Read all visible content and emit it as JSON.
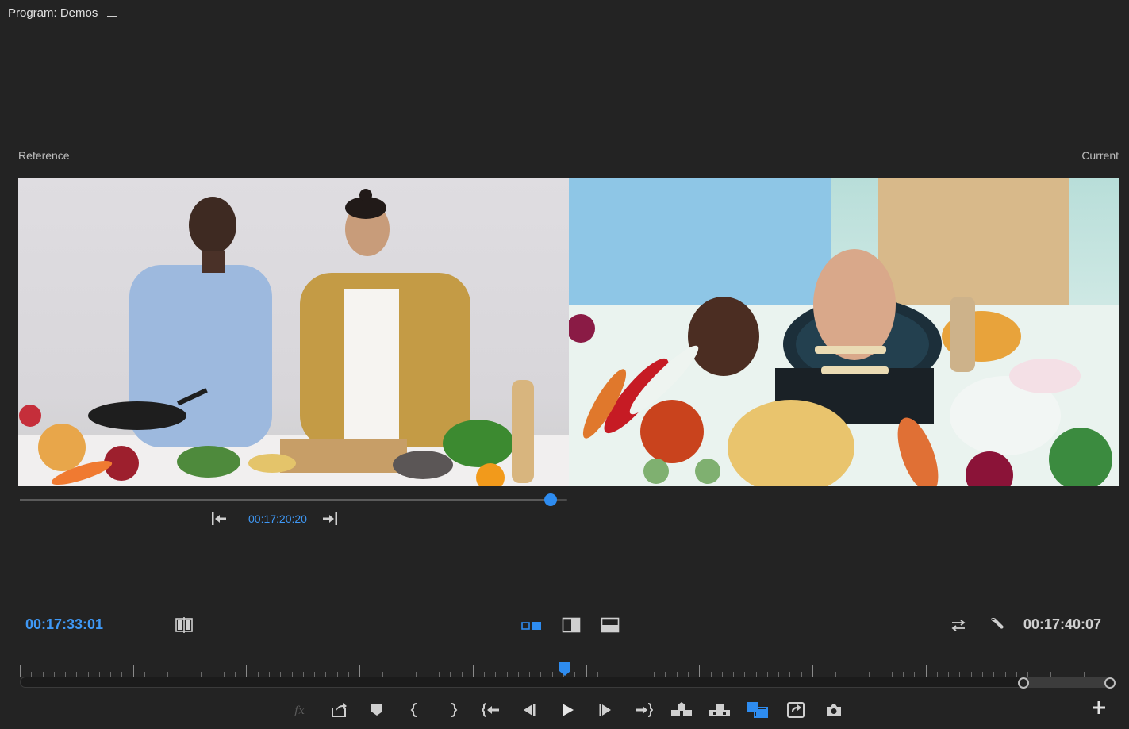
{
  "panel": {
    "title": "Program: Demos",
    "menu_icon": "hamburger-menu-icon"
  },
  "viewer": {
    "reference_label": "Reference",
    "current_label": "Current"
  },
  "reference": {
    "timecode": "00:17:20:20",
    "scrub_position": 0.97,
    "go_to_previous_edit_icon": "go-to-previous-edit-icon",
    "go_to_next_edit_icon": "go-to-next-edit-icon"
  },
  "playhead": {
    "current_timecode": "00:17:33:01",
    "duration_timecode": "00:17:40:07"
  },
  "toolbar": {
    "comparison_icon": "comparison-view-icon",
    "side_by_side_icon": "side-by-side-icon",
    "vertical_split_icon": "vertical-split-icon",
    "horizontal_split_icon": "horizontal-split-icon",
    "swap_icon": "swap-sides-icon",
    "settings_icon": "wrench-icon"
  },
  "timeline": {
    "playhead_position": 0.5,
    "zoom_range": [
      0.92,
      1.0
    ]
  },
  "transport": {
    "buttons": [
      "fx-icon",
      "export-frame-icon",
      "add-marker-icon",
      "mark-in-icon",
      "mark-out-icon",
      "go-to-in-icon",
      "step-back-icon",
      "play-icon",
      "step-forward-icon",
      "go-to-out-icon",
      "insert-icon",
      "overwrite-icon",
      "comparison-view-icon",
      "lift-icon",
      "camera-icon",
      "add-button-icon"
    ]
  },
  "colors": {
    "accent": "#2e8cf0",
    "background": "#232323",
    "text": "#d6d6d6"
  }
}
